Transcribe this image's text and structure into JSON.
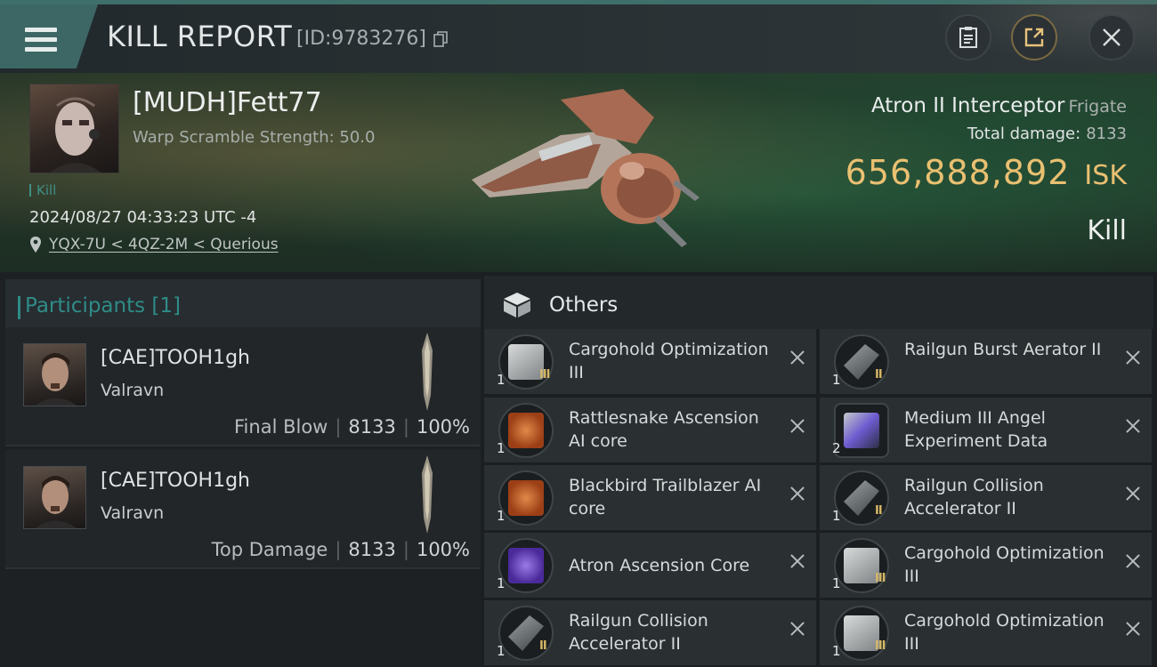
{
  "header": {
    "title": "KILL REPORT",
    "id_label": "[ID:9783276]",
    "buttons": {
      "report": "clipboard-icon",
      "share": "share-icon",
      "close": "close-icon"
    }
  },
  "victim": {
    "name": "[MUDH]Fett77",
    "warp_scramble": "Warp Scramble Strength: 50.0",
    "tag": "Kill",
    "timestamp": "2024/08/27 04:33:23 UTC -4",
    "location": "YQX-7U < 4QZ-2M < Querious",
    "ship_name": "Atron II Interceptor",
    "ship_class": "Frigate",
    "total_damage_label": "Total damage:",
    "total_damage": "8133",
    "isk_value": "656,888,892",
    "isk_unit": "ISK",
    "result": "Kill"
  },
  "participants": {
    "title": "Participants [1]",
    "rows": [
      {
        "name": "[CAE]TOOH1gh",
        "corp": "Valravn",
        "label": "Final Blow",
        "damage": "8133",
        "percent": "100%"
      },
      {
        "name": "[CAE]TOOH1gh",
        "corp": "Valravn",
        "label": "Top Damage",
        "damage": "8133",
        "percent": "100%"
      }
    ]
  },
  "others": {
    "title": "Others",
    "items": [
      {
        "name": "Cargohold Optimization III",
        "qty": "1",
        "tier": "III",
        "icon": "cargohold-module-icon"
      },
      {
        "name": "Railgun Burst Aerator II",
        "qty": "1",
        "tier": "II",
        "icon": "railgun-module-icon"
      },
      {
        "name": "Rattlesnake Ascension AI core",
        "qty": "1",
        "tier": "",
        "icon": "ai-core-orange-icon"
      },
      {
        "name": "Medium III Angel Experiment Data",
        "qty": "2",
        "tier": "",
        "icon": "experiment-data-icon"
      },
      {
        "name": "Blackbird Trailblazer AI core",
        "qty": "1",
        "tier": "",
        "icon": "ai-core-orange-icon"
      },
      {
        "name": "Railgun Collision Accelerator II",
        "qty": "1",
        "tier": "II",
        "icon": "railgun-module-icon"
      },
      {
        "name": "Atron Ascension Core",
        "qty": "1",
        "tier": "",
        "icon": "ascension-core-purple-icon"
      },
      {
        "name": "Cargohold Optimization III",
        "qty": "1",
        "tier": "III",
        "icon": "cargohold-module-icon"
      },
      {
        "name": "Railgun Collision Accelerator II",
        "qty": "1",
        "tier": "II",
        "icon": "railgun-module-icon"
      },
      {
        "name": "Cargohold Optimization III",
        "qty": "1",
        "tier": "III",
        "icon": "cargohold-module-icon"
      }
    ]
  },
  "colors": {
    "accent_teal": "#2f8c87",
    "isk_gold": "#e9c071",
    "tier_gold": "#d6b867"
  }
}
